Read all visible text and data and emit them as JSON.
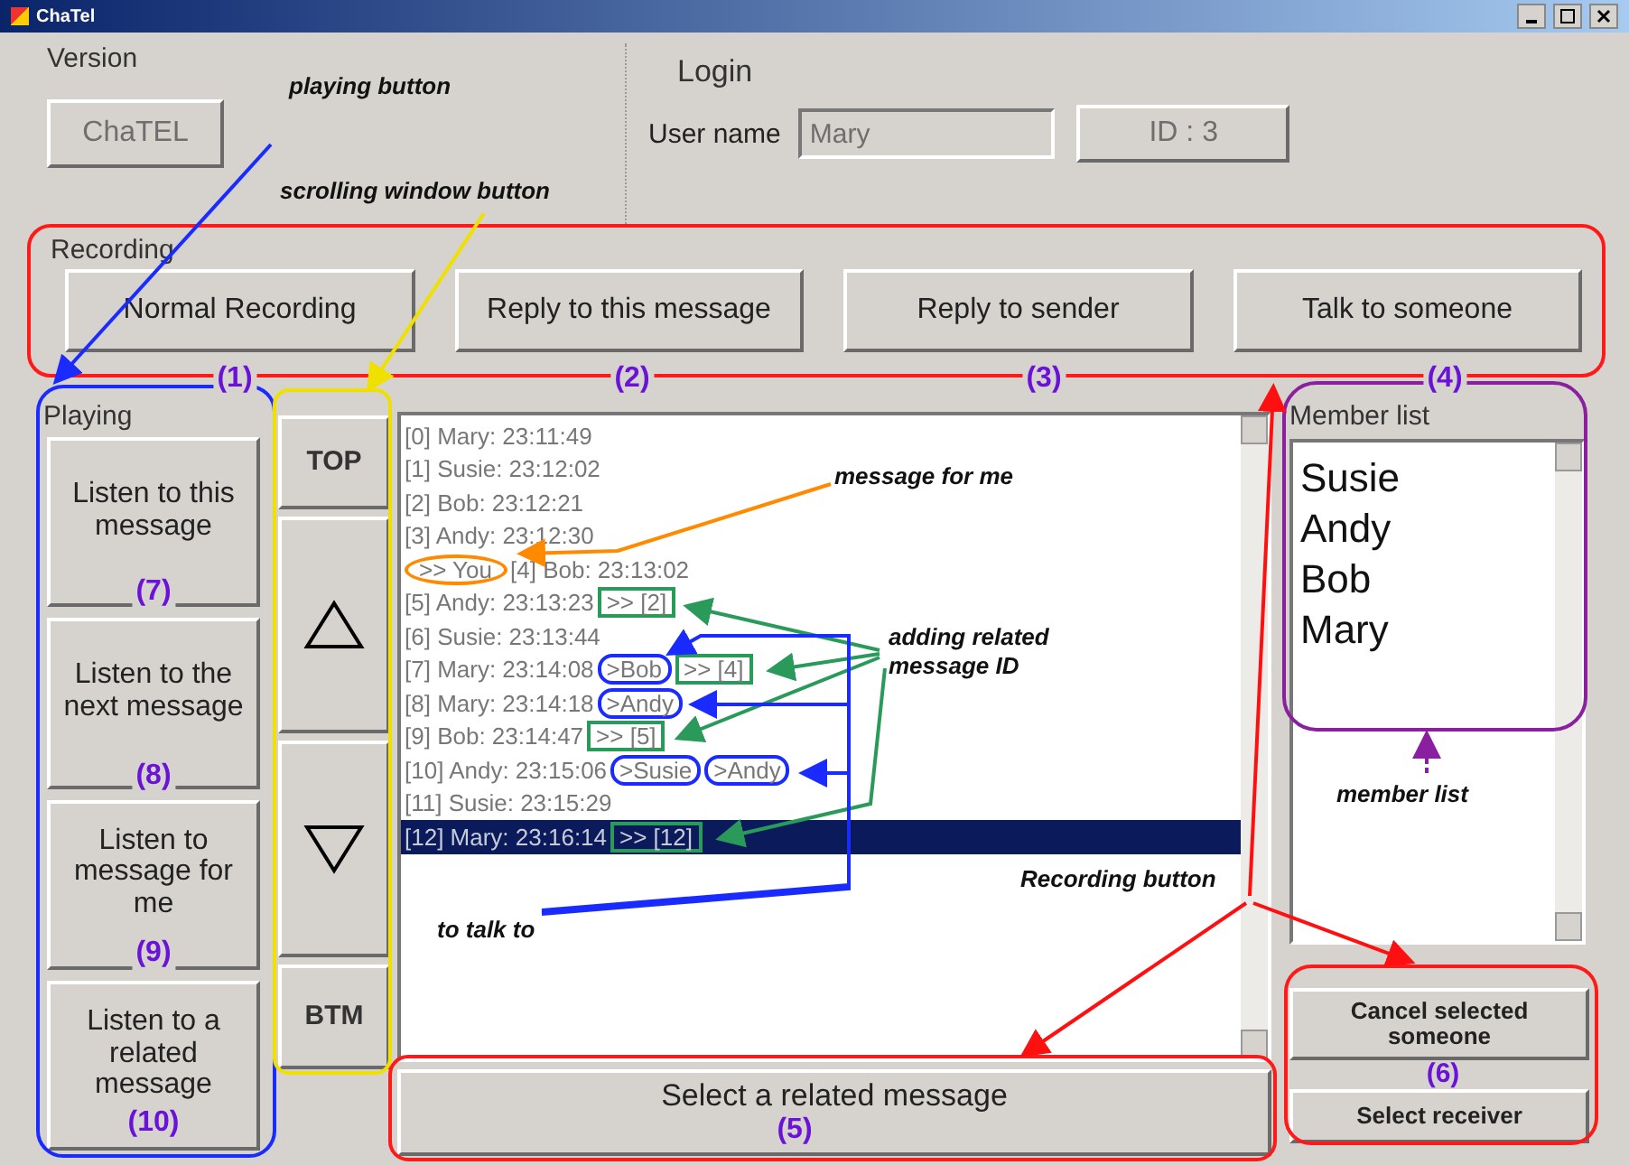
{
  "window": {
    "title": "ChaTel"
  },
  "version": {
    "label": "Version",
    "button": "ChaTEL"
  },
  "login": {
    "label": "Login",
    "user_label": "User name",
    "user_value": "Mary",
    "id_button": "ID : 3"
  },
  "recording": {
    "label": "Recording",
    "buttons": [
      {
        "label": "Normal Recording",
        "callout": "(1)"
      },
      {
        "label": "Reply to this message",
        "callout": "(2)"
      },
      {
        "label": "Reply to sender",
        "callout": "(3)"
      },
      {
        "label": "Talk to someone",
        "callout": "(4)"
      }
    ]
  },
  "playing": {
    "label": "Playing",
    "buttons": [
      {
        "label": "Listen to this message",
        "callout": "(7)"
      },
      {
        "label": "Listen to the next message",
        "callout": "(8)"
      },
      {
        "label": "Listen to message for me",
        "callout": "(9)"
      },
      {
        "label": "Listen to a related message",
        "callout": "(10)"
      }
    ]
  },
  "scroll_buttons": [
    {
      "kind": "text",
      "label": "TOP"
    },
    {
      "kind": "up"
    },
    {
      "kind": "down"
    },
    {
      "kind": "text",
      "label": "BTM"
    }
  ],
  "messages": [
    {
      "index": "[0]",
      "text": "Mary: 23:11:49",
      "for_me": false,
      "selected": false
    },
    {
      "index": "[1]",
      "text": "Susie: 23:12:02",
      "for_me": false,
      "selected": false
    },
    {
      "index": "[2]",
      "text": "Bob: 23:12:21",
      "for_me": false,
      "selected": false
    },
    {
      "index": "[3]",
      "text": "Andy: 23:12:30",
      "for_me": false,
      "selected": false
    },
    {
      "index": "[4]",
      "text": "Bob: 23:13:02",
      "for_me": true,
      "for_me_label": ">> You",
      "selected": false
    },
    {
      "index": "[5]",
      "text": "Andy: 23:13:23",
      "for_me": false,
      "related": ">> [2]",
      "selected": false
    },
    {
      "index": "[6]",
      "text": "Susie: 23:13:44",
      "for_me": false,
      "selected": false
    },
    {
      "index": "[7]",
      "text": "Mary: 23:14:08",
      "for_me": false,
      "to": [
        ">Bob"
      ],
      "related": ">> [4]",
      "selected": false
    },
    {
      "index": "[8]",
      "text": "Mary: 23:14:18",
      "for_me": false,
      "to": [
        ">Andy"
      ],
      "selected": false
    },
    {
      "index": "[9]",
      "text": "Bob: 23:14:47",
      "for_me": false,
      "related": ">> [5]",
      "selected": false
    },
    {
      "index": "[10]",
      "text": "Andy: 23:15:06",
      "for_me": false,
      "to": [
        ">Susie",
        ">Andy"
      ],
      "selected": false
    },
    {
      "index": "[11]",
      "text": "Susie: 23:15:29",
      "for_me": false,
      "selected": false
    },
    {
      "index": "[12]",
      "text": "Mary: 23:16:14",
      "for_me": false,
      "related": ">> [12]",
      "selected": true
    }
  ],
  "select_related": {
    "label": "Select a related message",
    "callout": "(5)"
  },
  "members": {
    "label": "Member list",
    "items": [
      "Susie",
      "Andy",
      "Bob",
      "Mary"
    ]
  },
  "receiver_buttons": [
    {
      "label": "Cancel selected someone"
    },
    {
      "label": "Select receiver"
    }
  ],
  "receiver_callout": "(6)",
  "annotations": [
    {
      "text": "playing button"
    },
    {
      "text": "scrolling window button"
    },
    {
      "text": "message for me"
    },
    {
      "text": "adding related message ID"
    },
    {
      "text": "member list"
    },
    {
      "text": "Recording button"
    },
    {
      "text": "to talk to"
    }
  ]
}
